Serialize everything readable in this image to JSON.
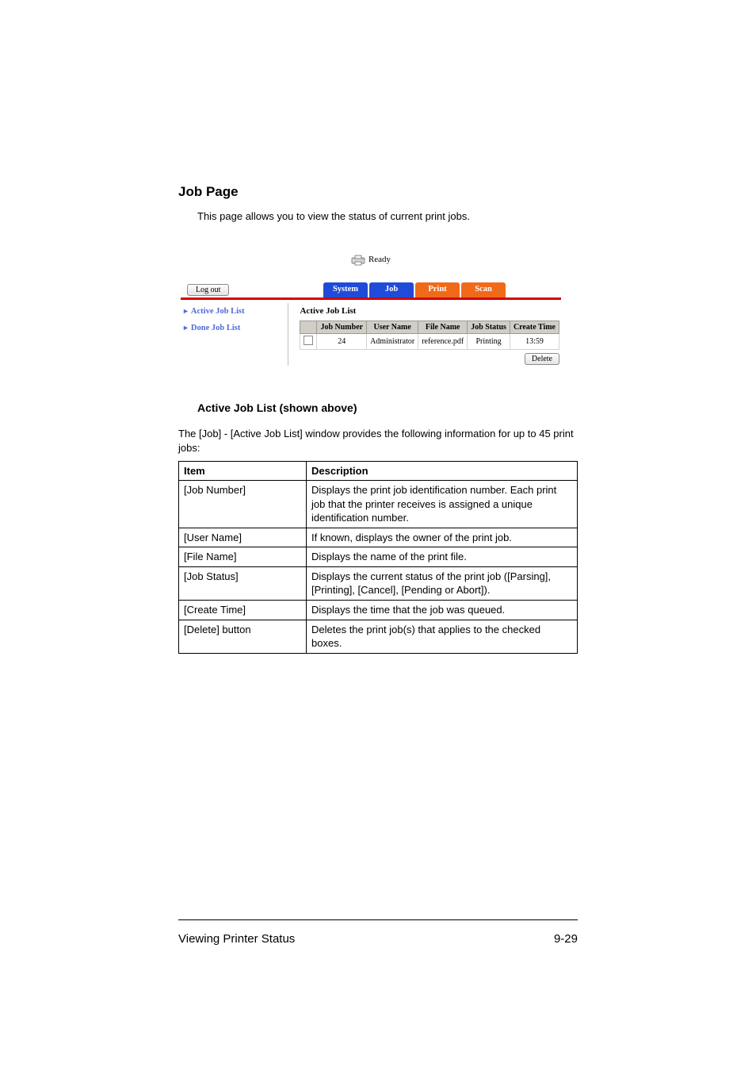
{
  "page": {
    "heading": "Job Page",
    "intro": "This page allows you to view the status of current print jobs."
  },
  "panel": {
    "status_text": "Ready",
    "logout_label": "Log out",
    "tabs": {
      "system": "System",
      "job": "Job",
      "print": "Print",
      "scan": "Scan"
    },
    "sidebar": {
      "active": "Active Job List",
      "done": "Done Job List"
    },
    "table": {
      "title": "Active Job List",
      "headers": {
        "job_number": "Job Number",
        "user_name": "User Name",
        "file_name": "File Name",
        "job_status": "Job Status",
        "create_time": "Create Time"
      },
      "row": {
        "job_number": "24",
        "user_name": "Administrator",
        "file_name": "reference.pdf",
        "job_status": "Printing",
        "create_time": "13:59"
      },
      "delete_label": "Delete"
    }
  },
  "doc": {
    "subheading": "Active Job List (shown above)",
    "paragraph": "The [Job] - [Active Job List] window provides the following information for up to 45 print jobs:",
    "headers": {
      "item": "Item",
      "description": "Description"
    },
    "rows": [
      {
        "item": "[Job Number]",
        "desc": "Displays the print job identification number. Each print job that the printer receives is assigned a unique identification number."
      },
      {
        "item": "[User Name]",
        "desc": "If known, displays the owner of the print job."
      },
      {
        "item": "[File Name]",
        "desc": "Displays the name of the print file."
      },
      {
        "item": "[Job Status]",
        "desc": "Displays the current status of the print job ([Parsing], [Printing], [Cancel], [Pending or Abort])."
      },
      {
        "item": "[Create Time]",
        "desc": "Displays the time that the job was queued."
      },
      {
        "item": "[Delete] button",
        "desc": "Deletes the print job(s) that applies to the checked boxes."
      }
    ]
  },
  "footer": {
    "left": "Viewing Printer Status",
    "right": "9-29"
  }
}
